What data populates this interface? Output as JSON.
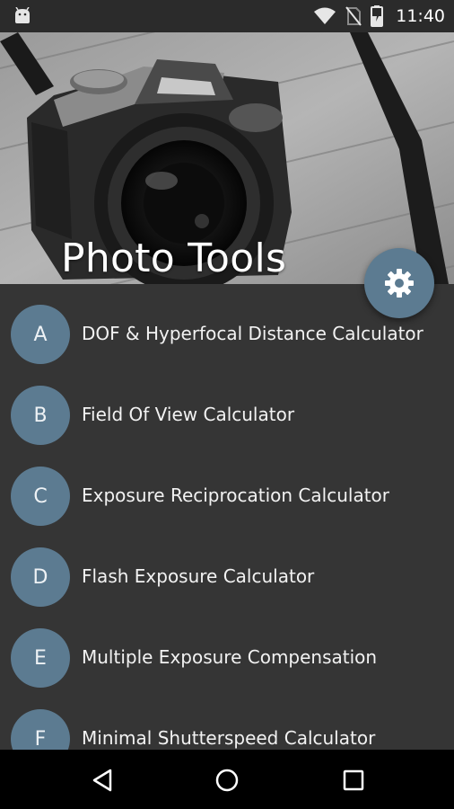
{
  "status_bar": {
    "time": "11:40",
    "icons": [
      "android-icon",
      "wifi-icon",
      "no-sim-icon",
      "battery-charging-icon"
    ]
  },
  "header": {
    "title": "Photo Tools",
    "image_subject": "camera-photo"
  },
  "fab": {
    "icon": "settings-gear-icon"
  },
  "list": {
    "items": [
      {
        "letter": "A",
        "label": "DOF & Hyperfocal Distance Calculator"
      },
      {
        "letter": "B",
        "label": "Field Of View Calculator"
      },
      {
        "letter": "C",
        "label": "Exposure Reciprocation Calculator"
      },
      {
        "letter": "D",
        "label": "Flash Exposure Calculator"
      },
      {
        "letter": "E",
        "label": "Multiple Exposure Compensation"
      },
      {
        "letter": "F",
        "label": "Minimal Shutterspeed Calculator"
      }
    ]
  },
  "nav_bar": {
    "buttons": [
      "back-icon",
      "home-icon",
      "recents-icon"
    ]
  },
  "colors": {
    "accent": "#5c7b91",
    "background": "#353535",
    "status_bar": "#2b2b2b",
    "nav_bar": "#000000"
  }
}
